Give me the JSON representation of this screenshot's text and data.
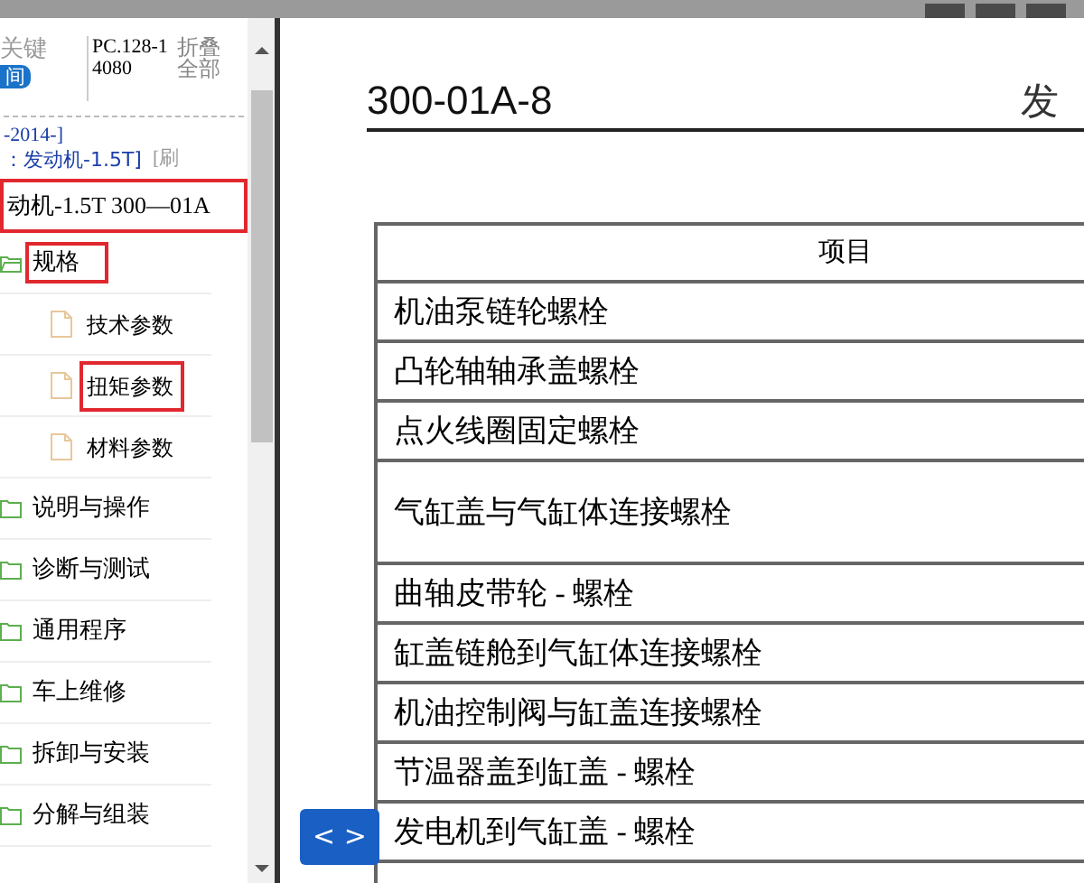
{
  "sidebar": {
    "search_label": "关键",
    "search_button": "间",
    "code": "PC.128-14080",
    "collapse_all": "折叠全部",
    "path_lines": [
      {
        "kind": "plain",
        "text": "-2014-]"
      },
      {
        "kind": "link",
        "text": "：发动机-1.5T]",
        "extra": "[刷"
      }
    ],
    "tree": {
      "label": "动机-1.5T 300—01A",
      "highlighted": true,
      "children": [
        {
          "label": "规格",
          "kind": "folder",
          "expanded": true,
          "highlighted": true,
          "children": [
            {
              "label": "技术参数",
              "kind": "doc",
              "highlighted": false
            },
            {
              "label": "扭矩参数",
              "kind": "doc",
              "highlighted": true
            },
            {
              "label": "材料参数",
              "kind": "doc",
              "highlighted": false
            }
          ]
        },
        {
          "label": "说明与操作",
          "kind": "folder",
          "expanded": false,
          "highlighted": false
        },
        {
          "label": "诊断与测试",
          "kind": "folder",
          "expanded": false,
          "highlighted": false
        },
        {
          "label": "通用程序",
          "kind": "folder",
          "expanded": false,
          "highlighted": false
        },
        {
          "label": "车上维修",
          "kind": "folder",
          "expanded": false,
          "highlighted": false
        },
        {
          "label": "拆卸与安装",
          "kind": "folder",
          "expanded": false,
          "highlighted": false
        },
        {
          "label": "分解与组装",
          "kind": "folder",
          "expanded": false,
          "highlighted": false
        }
      ]
    }
  },
  "document": {
    "code": "300-01A-8",
    "section": "发",
    "table": {
      "columns": [
        "项目"
      ],
      "rows": [
        {
          "item": "机油泵链轮螺栓",
          "kind": "normal"
        },
        {
          "item": "凸轮轴轴承盖螺栓",
          "kind": "normal"
        },
        {
          "item": "点火线圈固定螺栓",
          "kind": "normal"
        },
        {
          "item": "气缸盖与气缸体连接螺栓",
          "kind": "tall"
        },
        {
          "item": "曲轴皮带轮 - 螺栓",
          "kind": "normal"
        },
        {
          "item": "缸盖链舱到气缸体连接螺栓",
          "kind": "normal"
        },
        {
          "item": "机油控制阀与缸盖连接螺栓",
          "kind": "normal"
        },
        {
          "item": "节温器盖到缸盖 - 螺栓",
          "kind": "normal"
        },
        {
          "item": "发电机到气缸盖 - 螺栓",
          "kind": "normal"
        }
      ]
    }
  },
  "toggle_button": "< >"
}
